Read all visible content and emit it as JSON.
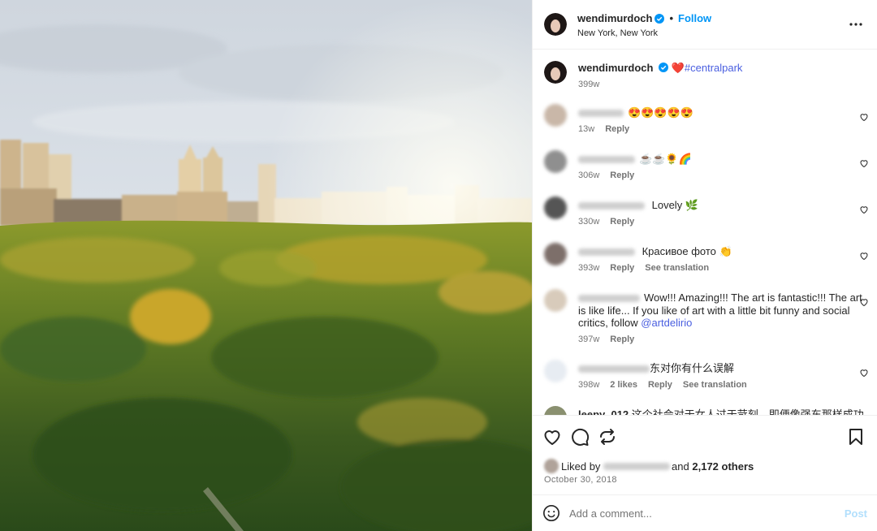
{
  "post": {
    "username": "wendimurdoch",
    "follow_label": "Follow",
    "location": "New York, New York",
    "more_icon": "more-horizontal-icon"
  },
  "caption": {
    "username": "wendimurdoch",
    "heart": "❤️",
    "hashtag": "#centralpark",
    "time": "399w"
  },
  "comments": [
    {
      "text": "😍😍😍😍😍",
      "time": "13w",
      "reply": "Reply"
    },
    {
      "text": "☕☕🌻🌈",
      "time": "306w",
      "reply": "Reply"
    },
    {
      "text": " Lovely 🌿",
      "time": "330w",
      "reply": "Reply"
    },
    {
      "text": " Красивое фото 👏",
      "time": "393w",
      "reply": "Reply",
      "translate": "See translation"
    },
    {
      "text_a": "Wow!!! Amazing!!! The art is fantastic!!! The art is like life... If you like of art with a little bit funny and social critics, follow ",
      "mention": "@artdelirio",
      "time": "397w",
      "reply": "Reply"
    },
    {
      "text": "东对你有什么误解",
      "time": "398w",
      "likes": "2 likes",
      "reply": "Reply",
      "translate": "See translation"
    },
    {
      "username": "leepy_012",
      "text": "这个社会对于女人过于苛刻，即便像强东那样成功的"
    }
  ],
  "actions": {
    "icons": [
      "heart-icon",
      "comment-icon",
      "share-icon",
      "bookmark-icon"
    ]
  },
  "likes": {
    "prefix": "Liked by ",
    "and": " and ",
    "count": "2,172 others"
  },
  "date": "October 30, 2018",
  "add_comment": {
    "placeholder": "Add a comment...",
    "post_label": "Post"
  },
  "colors": {
    "link": "#0095f6",
    "hashtag": "#4a5fe0",
    "verified": "#0095f6"
  }
}
